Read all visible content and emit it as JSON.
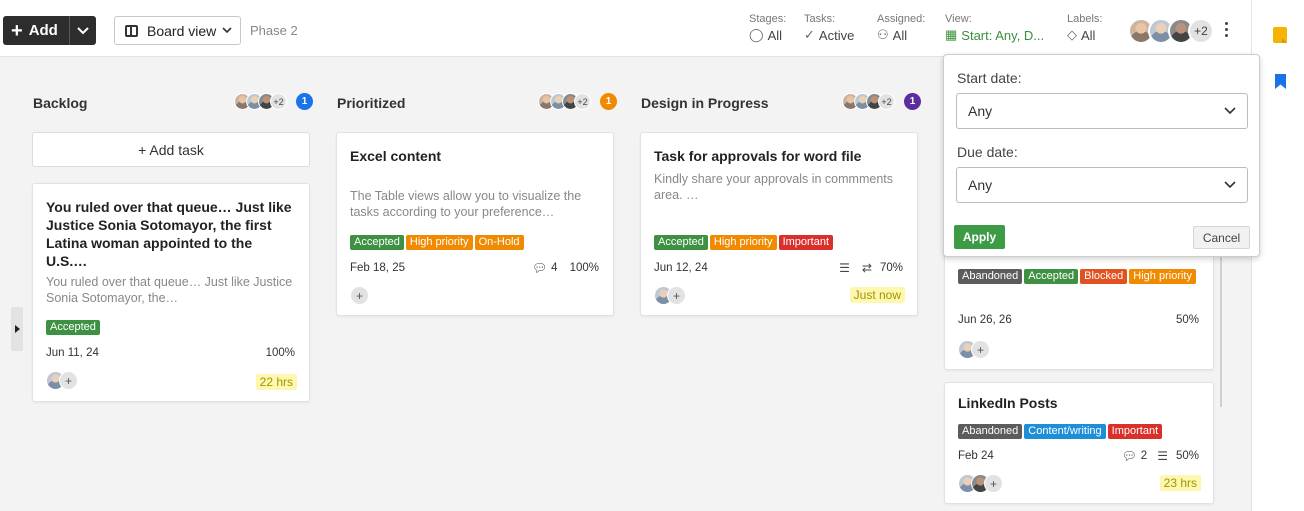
{
  "toolbar": {
    "add_label": "Add",
    "view_label": "Board view",
    "phase": "Phase 2"
  },
  "filters": {
    "stages": {
      "label": "Stages:",
      "value": "All"
    },
    "tasks": {
      "label": "Tasks:",
      "value": "Active"
    },
    "assigned": {
      "label": "Assigned:",
      "value": "All"
    },
    "view": {
      "label": "View:",
      "value": "Start: Any, D..."
    },
    "labels": {
      "label": "Labels:",
      "value": "All"
    }
  },
  "header_members_extra": "+2",
  "columns": [
    {
      "title": "Backlog",
      "extra": "+2",
      "count": "1",
      "count_color": "#1a73e8"
    },
    {
      "title": "Prioritized",
      "extra": "+2",
      "count": "1",
      "count_color": "#f08a00"
    },
    {
      "title": "Design in Progress",
      "extra": "+2",
      "count": "1",
      "count_color": "#5b2d9e"
    }
  ],
  "add_task_label": "+ Add task",
  "cards": {
    "backlog": {
      "title": "You ruled over that queue… Just like Justice Sonia Sotomayor, the first Latina woman appointed to the U.S.…",
      "desc": "You ruled over that queue… Just like Justice Sonia Sotomayor, the…",
      "tags": [
        {
          "text": "Accepted",
          "color": "#3e9142"
        }
      ],
      "date": "Jun 11, 24",
      "progress": "100%",
      "time": "22 hrs"
    },
    "prioritized": {
      "title": "Excel content",
      "desc": "The Table views allow you to visualize the tasks according to your preference…",
      "tags": [
        {
          "text": "Accepted",
          "color": "#3e9142"
        },
        {
          "text": "High priority",
          "color": "#f08a00"
        },
        {
          "text": "On-Hold",
          "color": "#f08a00"
        }
      ],
      "date": "Feb 18, 25",
      "comments": "4",
      "progress": "100%"
    },
    "design": {
      "title": "Task for approvals for word file",
      "desc": "Kindly share your approvals in commments area. …",
      "tags": [
        {
          "text": "Accepted",
          "color": "#3e9142"
        },
        {
          "text": "High priority",
          "color": "#f08a00"
        },
        {
          "text": "Important",
          "color": "#d9302c"
        }
      ],
      "date": "Jun 12, 24",
      "progress": "70%",
      "time": "Just now"
    },
    "fourth_a": {
      "tags": [
        {
          "text": "Abandoned",
          "color": "#5c5c5c"
        },
        {
          "text": "Accepted",
          "color": "#3e9142"
        },
        {
          "text": "Blocked",
          "color": "#e0521f"
        },
        {
          "text": "High priority",
          "color": "#f08a00"
        }
      ],
      "date": "Jun 26, 26",
      "progress": "50%"
    },
    "fourth_b": {
      "title": "LinkedIn Posts",
      "tags": [
        {
          "text": "Abandoned",
          "color": "#5c5c5c"
        },
        {
          "text": "Content/writing",
          "color": "#1e8ed6"
        },
        {
          "text": "Important",
          "color": "#d9302c"
        }
      ],
      "date": "Feb 24",
      "comments": "2",
      "progress": "50%",
      "time": "23 hrs"
    }
  },
  "popover": {
    "start_label": "Start date:",
    "start_value": "Any",
    "due_label": "Due date:",
    "due_value": "Any",
    "apply": "Apply",
    "cancel": "Cancel"
  }
}
